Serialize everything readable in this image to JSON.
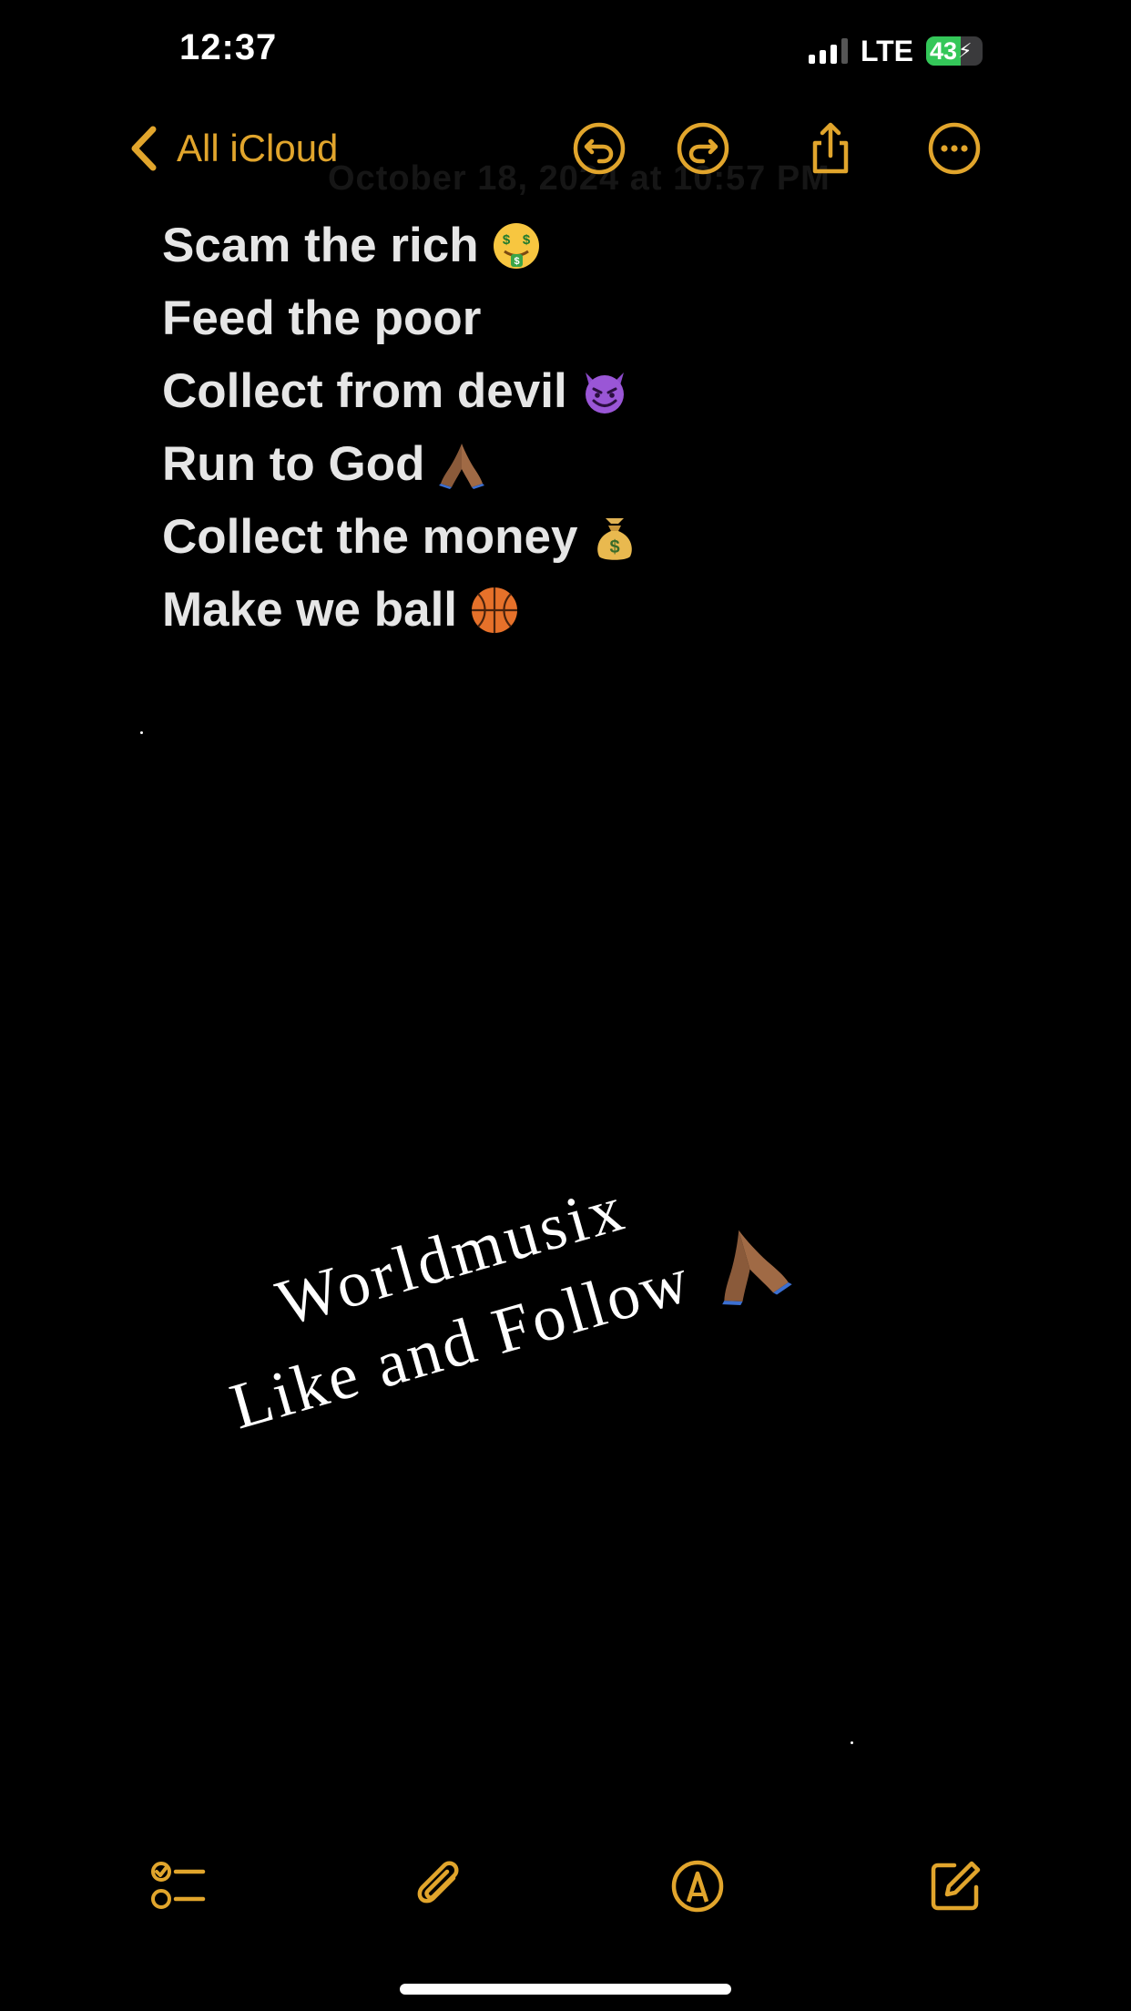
{
  "status_bar": {
    "time": "12:37",
    "network": "LTE",
    "battery": "43"
  },
  "nav": {
    "back_label": "All iCloud",
    "faint_date": "October 18, 2024 at 10:57 PM"
  },
  "note": {
    "lines": [
      {
        "text": "Scam the rich",
        "emoji": "money-mouth-face-icon"
      },
      {
        "text": "Feed the poor",
        "emoji": ""
      },
      {
        "text": "Collect from devil",
        "emoji": "smiling-devil-icon"
      },
      {
        "text": "Run to God",
        "emoji": "praying-hands-icon"
      },
      {
        "text": "Collect the money",
        "emoji": "money-bag-icon"
      },
      {
        "text": "Make we ball",
        "emoji": "basketball-icon"
      }
    ]
  },
  "watermark": {
    "line1": "Worldmusix",
    "line2": "Like and Follow"
  },
  "colors": {
    "accent": "#e1a52c",
    "background": "#000000",
    "text": "#e6e6e6"
  }
}
